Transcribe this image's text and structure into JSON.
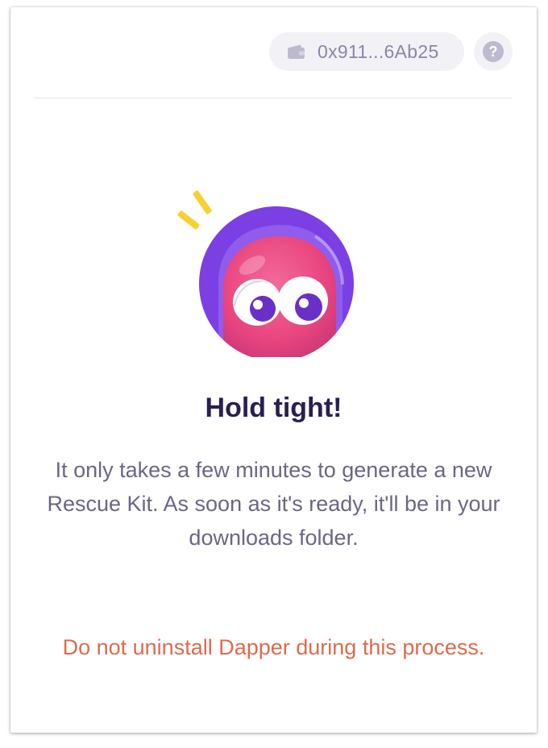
{
  "header": {
    "wallet_address": "0x911...6Ab25",
    "wallet_icon": "wallet-icon",
    "help_icon": "help-icon",
    "help_label": "?"
  },
  "main": {
    "mascot": "mascot-illustration",
    "title": "Hold tight!",
    "message": "It only takes a few minutes to generate a new Rescue Kit. As soon as it's ready, it'll be in your downloads folder.",
    "warning": "Do not uninstall Dapper during this process."
  },
  "colors": {
    "title": "#2a1f4e",
    "body": "#6a6785",
    "warning": "#dc6b4e",
    "mascot_purple": "#7b3fe4",
    "mascot_pink": "#f0508c",
    "accent_yellow": "#f7d032"
  }
}
